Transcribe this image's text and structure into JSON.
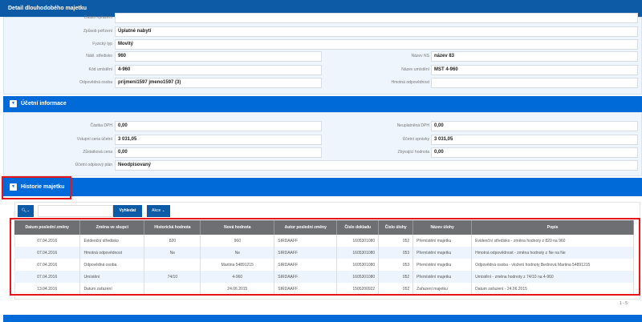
{
  "header": {
    "title": "Detail dlouhodobého majetku"
  },
  "general": {
    "full": [
      {
        "label": "Datum vyřazení",
        "value": ""
      },
      {
        "label": "Způsob pořízení",
        "value": "Úplatné nabytí"
      },
      {
        "label": "Fyzický typ",
        "value": "Movitý"
      }
    ],
    "left": [
      {
        "label": "Nákl. středisko",
        "value": "960"
      },
      {
        "label": "Kód umístění",
        "value": "4-960"
      },
      {
        "label": "Odpovědná osoba",
        "value": "prijmeni1597 jmeno1597 (3)"
      }
    ],
    "right": [
      {
        "label": "Název NS",
        "value": "název 83"
      },
      {
        "label": "Název umístění",
        "value": "MST 4-960"
      },
      {
        "label": "Hmotná odpovědnost",
        "value": ""
      }
    ]
  },
  "accounting": {
    "title": "Účetní informace",
    "left": [
      {
        "label": "Částka DPH",
        "value": "0,00"
      },
      {
        "label": "Vstupní cena účetní",
        "value": "3 031,05"
      },
      {
        "label": "Zůstatková cena",
        "value": "0,00"
      }
    ],
    "right": [
      {
        "label": "Neuplatněná DPH",
        "value": "0,00"
      },
      {
        "label": "Účetní oprávky",
        "value": "3 031,05"
      },
      {
        "label": "Zbývající hodnota",
        "value": "0,00"
      }
    ],
    "plan": {
      "label": "Účetní odpisový plán",
      "value": "Neodpisovaný"
    }
  },
  "history": {
    "title": "Historie majetku",
    "search_label": "Vyhledat",
    "actions_label": "Akce",
    "columns": [
      "Datum poslední změny",
      "Změna ve skupci",
      "Historická hodnota",
      "Nová hodnota",
      "Autor poslední změny",
      "Číslo dokladu",
      "Číslo úlohy",
      "Název úlohy",
      "Popis"
    ],
    "rows": [
      [
        "07.04.2016",
        "Evidenční středisko",
        "820",
        "960",
        "SIRDAAFF",
        "1605301080",
        "052",
        "Přemístění majetku",
        "Evidenční středisko - změna hodnoty z 820 na 960"
      ],
      [
        "07.04.2016",
        "Hmotná odpovědnost",
        "Ne",
        "Ne",
        "SIRDAAFF",
        "1605301080",
        "053",
        "Přemístění majetku",
        "Hmotná odpovědnost - změna hodnoty z Ne na Ne"
      ],
      [
        "07.04.2016",
        "Odpovědná osoba",
        "",
        "Martina 54891215",
        "SIRDAAFF",
        "1605301080",
        "053",
        "Přemístění majetku",
        "Odpovědná osoba - vložení hodnoty Bednová Martina 54891215"
      ],
      [
        "07.04.2016",
        "Umístění",
        "74/10",
        "4-960",
        "SIRDAAFF",
        "1605301080",
        "052",
        "Přemístění majetku",
        "Umístění - změna hodnoty z 74/10 na 4-960"
      ],
      [
        "13.04.2016",
        "Datum zařazení",
        "",
        "24.06.2015",
        "SIRDAAFF",
        "1505200922",
        "052",
        "Zařazení majetku",
        "Datum zařazení - 24.06.2015"
      ]
    ],
    "pager": "1 - 5"
  }
}
